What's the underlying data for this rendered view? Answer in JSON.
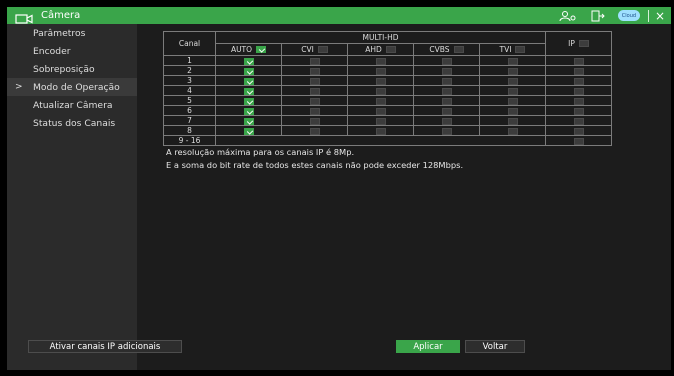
{
  "window": {
    "title": "Câmera",
    "cloud_label": "Cloud",
    "close_icon": "×"
  },
  "colors": {
    "accent": "#3aa54a",
    "sidebar": "#2b2b2b",
    "panel": "#1c1c1c"
  },
  "sidebar": {
    "items": [
      {
        "label": "Parâmetros",
        "active": false
      },
      {
        "label": "Encoder",
        "active": false
      },
      {
        "label": "Sobreposição",
        "active": false
      },
      {
        "label": "Modo de Operação",
        "active": true
      },
      {
        "label": "Atualizar Câmera",
        "active": false
      },
      {
        "label": "Status dos Canais",
        "active": false
      }
    ],
    "active_marker": ">"
  },
  "table": {
    "canal_header": "Canal",
    "group_header": "MULTI-HD",
    "columns": [
      "AUTO",
      "CVI",
      "AHD",
      "CVBS",
      "TVI"
    ],
    "ip_header": "IP",
    "rows": [
      {
        "canal": "1",
        "auto": true
      },
      {
        "canal": "2",
        "auto": true
      },
      {
        "canal": "3",
        "auto": true
      },
      {
        "canal": "4",
        "auto": true
      },
      {
        "canal": "5",
        "auto": true
      },
      {
        "canal": "6",
        "auto": true
      },
      {
        "canal": "7",
        "auto": true
      },
      {
        "canal": "8",
        "auto": true
      },
      {
        "canal": "9 - 16",
        "auto": false
      }
    ]
  },
  "notes": {
    "line1": "A resolução máxima para os canais IP é 8Mp.",
    "line2": "E a soma do bit rate de todos estes canais não pode exceder 128Mbps."
  },
  "buttons": {
    "extra": "Ativar canais IP adicionais",
    "apply": "Aplicar",
    "back": "Voltar"
  }
}
